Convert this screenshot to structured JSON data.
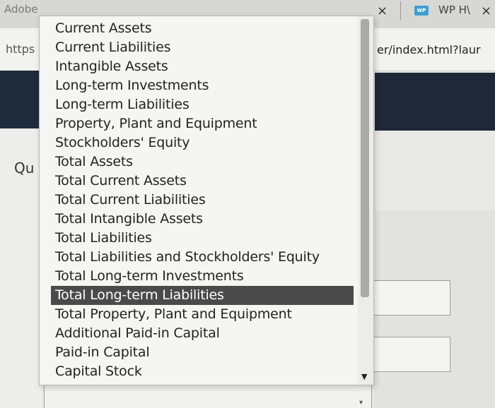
{
  "browser": {
    "tab_left_text": "Adobe",
    "tab_right_text": "WP H\\",
    "favicon_text": "WP",
    "close_glyph": "×"
  },
  "address": {
    "left_text": "https",
    "right_text": "er/index.html?laur"
  },
  "page": {
    "question_label": "Qu"
  },
  "dropdown": {
    "selected_index": 14,
    "options": [
      "Current Assets",
      "Current Liabilities",
      "Intangible Assets",
      "Long-term Investments",
      "Long-term Liabilities",
      "Property, Plant and Equipment",
      "Stockholders' Equity",
      "Total Assets",
      "Total Current Assets",
      "Total Current Liabilities",
      "Total Intangible Assets",
      "Total Liabilities",
      "Total Liabilities and Stockholders' Equity",
      "Total Long-term Investments",
      "Total Long-term Liabilities",
      "Total Property, Plant and Equipment",
      "Additional Paid-in Capital",
      "Paid-in Capital",
      "Capital Stock"
    ]
  },
  "icons": {
    "scroll_up": "up-arrow-icon",
    "scroll_down": "down-arrow-icon"
  }
}
